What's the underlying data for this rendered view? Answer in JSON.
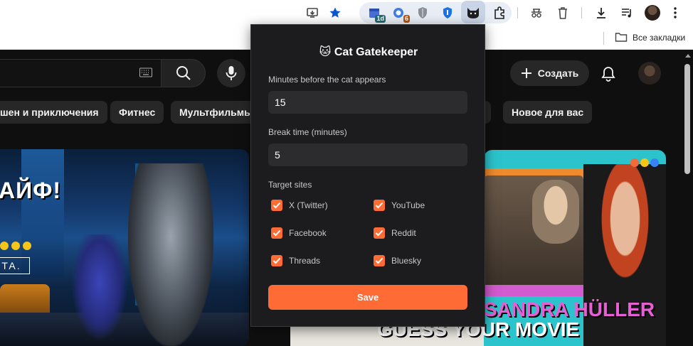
{
  "browser": {
    "badges": {
      "ext1": "1d",
      "ext2": "6"
    },
    "bookmarks_folder": "Все закладки"
  },
  "youtube": {
    "create_label": "Создать",
    "chips": [
      "шен и приключения",
      "Фитнес",
      "Мультфильмы",
      "Новое для вас"
    ],
    "left_thumb": {
      "title": "АЙФ!",
      "caption": "ТА."
    },
    "right_thumb": {
      "line1": "SANDRA HÜLLER",
      "line2": "GUESS YOUR MOVIE"
    }
  },
  "popup": {
    "title": "Cat Gatekeeper",
    "title_emoji": "🐱",
    "minutes_label": "Minutes before the cat appears",
    "minutes_value": "15",
    "break_label": "Break time (minutes)",
    "break_value": "5",
    "sites_label": "Target sites",
    "sites": [
      {
        "label": "X (Twitter)",
        "checked": true
      },
      {
        "label": "YouTube",
        "checked": true
      },
      {
        "label": "Facebook",
        "checked": true
      },
      {
        "label": "Reddit",
        "checked": true
      },
      {
        "label": "Threads",
        "checked": true
      },
      {
        "label": "Bluesky",
        "checked": true
      }
    ],
    "save_label": "Save"
  },
  "colors": {
    "accent": "#ff6b35",
    "popup_bg": "#1c1c1e",
    "input_bg": "#2c2c2e",
    "chip_bg": "#272727"
  }
}
